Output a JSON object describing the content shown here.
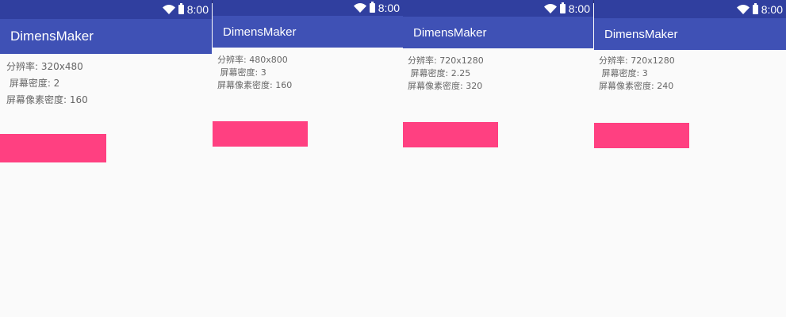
{
  "status_bar": {
    "time": "8:00",
    "wifi_icon": "wifi-icon",
    "battery_icon": "battery-icon"
  },
  "colors": {
    "status_bar": "#303f9f",
    "app_bar": "#3f51b5",
    "accent": "#ff4081",
    "background": "#fafafa",
    "text_secondary": "#666666"
  },
  "screens": [
    {
      "app_title": "DimensMaker",
      "resolution_line": "分辨率: 320x480",
      "density_line": " 屏幕密度: 2",
      "dpi_line": "屏幕像素密度: 160"
    },
    {
      "app_title": "DimensMaker",
      "resolution_line": "分辨率: 480x800",
      "density_line": " 屏幕密度: 3",
      "dpi_line": "屏幕像素密度: 160"
    },
    {
      "app_title": "DimensMaker",
      "resolution_line": "分辨率: 720x1280",
      "density_line": " 屏幕密度: 2.25",
      "dpi_line": "屏幕像素密度: 320"
    },
    {
      "app_title": "DimensMaker",
      "resolution_line": "分辨率: 720x1280",
      "density_line": " 屏幕密度: 3",
      "dpi_line": "屏幕像素密度: 240"
    }
  ]
}
